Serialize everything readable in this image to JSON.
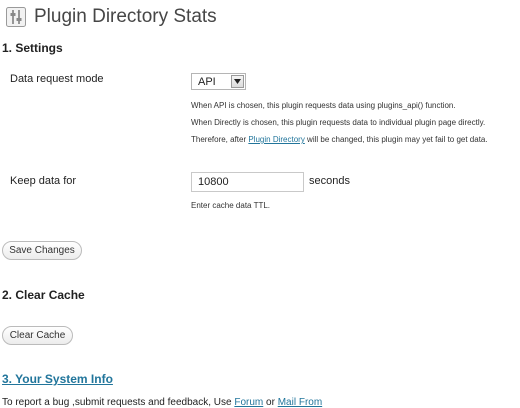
{
  "header": {
    "title": "Plugin Directory Stats",
    "icon": "settings-icon"
  },
  "settings": {
    "heading": "1. Settings",
    "mode": {
      "label": "Data request mode",
      "selected": "API",
      "desc_line1": "When API is chosen, this plugin requests data using plugins_api() function.",
      "desc_line2": "When Directly is chosen, this plugin requests data to individual plugin page directly.",
      "desc_line3_before": "Therefore, after ",
      "desc_line3_link": "Plugin Directory",
      "desc_line3_after": " will be changed, this plugin may yet fail to get data."
    },
    "keep": {
      "label": "Keep data for",
      "value": "10800",
      "unit": "seconds",
      "hint": "Enter cache data TTL."
    },
    "save_label": "Save Changes"
  },
  "clear_cache": {
    "heading": "2. Clear Cache",
    "button_label": "Clear Cache"
  },
  "system_info": {
    "heading": "3. Your System Info"
  },
  "footer": {
    "text_before": "To report a bug ,submit requests and feedback, Use ",
    "forum_label": "Forum",
    "or_text": " or ",
    "mail_label": "Mail From"
  },
  "colors": {
    "link": "#21759b",
    "heading": "#222222"
  }
}
